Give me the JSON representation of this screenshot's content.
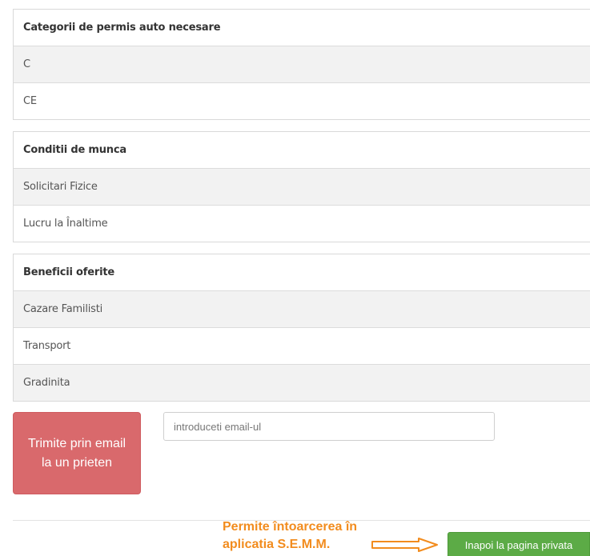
{
  "sections": [
    {
      "header": "Categorii de permis auto necesare",
      "items": [
        "C",
        "CE"
      ]
    },
    {
      "header": "Conditii de munca",
      "items": [
        "Solicitari Fizice",
        "Lucru la Înaltime"
      ]
    },
    {
      "header": "Beneficii oferite",
      "items": [
        "Cazare Familisti",
        "Transport",
        "Gradinita"
      ]
    }
  ],
  "share": {
    "button_label": "Trimite prin email la un prieten",
    "email_placeholder": "introduceti email-ul"
  },
  "annotation": {
    "line1": "Permite întoarcerea în",
    "line2": "aplicatia S.E.M.M."
  },
  "back_button_label": "Inapoi la pagina privata",
  "colors": {
    "send_button": "#d9696c",
    "back_button": "#5cab46",
    "annotation": "#f28c1e"
  },
  "icons": {
    "annotation_arrow": "arrow-right-icon"
  }
}
